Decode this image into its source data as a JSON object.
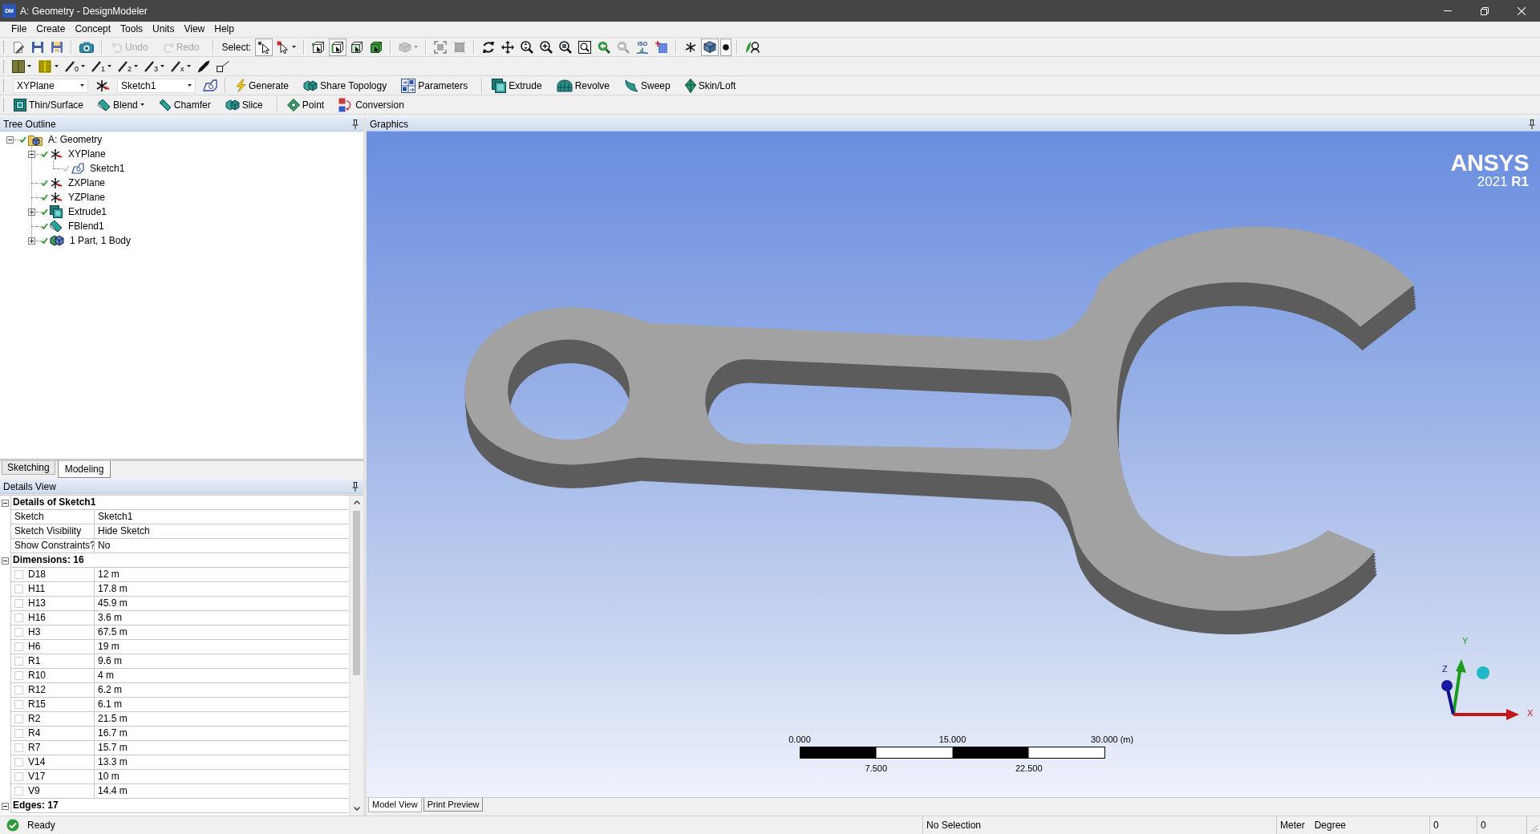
{
  "window": {
    "app_badge": "DM",
    "title": "A: Geometry - DesignModeler"
  },
  "menu": [
    "File",
    "Create",
    "Concept",
    "Tools",
    "Units",
    "View",
    "Help"
  ],
  "standard_toolbar": {
    "undo": {
      "label": "Undo",
      "disabled": true
    },
    "redo": {
      "label": "Redo",
      "disabled": true
    },
    "select_label": "Select:",
    "select_mode": {
      "selected": true
    },
    "selection_filters": [
      {
        "selected": false
      },
      {
        "selected": true
      },
      {
        "selected": false
      },
      {
        "selected": false
      }
    ],
    "extend_selection": {
      "disabled": true
    },
    "fit_buttons": [
      {
        "disabled": true
      },
      {
        "disabled": true
      }
    ],
    "view_tools": [
      {
        "disabled": false
      },
      {
        "disabled": false
      },
      {
        "disabled": false
      },
      {
        "disabled": false
      },
      {
        "disabled": false
      },
      {
        "disabled": false
      },
      {
        "disabled": false
      },
      {
        "disabled": true
      },
      {
        "label": "ISO",
        "disabled": false
      },
      {
        "disabled": false
      }
    ],
    "display_toggles": [
      {
        "selected": false
      },
      {
        "selected": true
      },
      {
        "selected": true
      }
    ]
  },
  "sketch_toolbar": {
    "line_buttons": [
      "0",
      "1",
      "2",
      "3",
      "x"
    ]
  },
  "feature_toolbar": {
    "plane": "XYPlane",
    "sketch": "Sketch1",
    "groups": [
      {
        "buttons": [
          {
            "label": "Generate"
          },
          {
            "label": "Share Topology"
          },
          {
            "label": "Parameters"
          }
        ]
      },
      {
        "buttons": [
          {
            "label": "Extrude"
          },
          {
            "label": "Revolve"
          },
          {
            "label": "Sweep"
          },
          {
            "label": "Skin/Loft"
          }
        ]
      }
    ]
  },
  "operations_toolbar": {
    "groups": [
      {
        "buttons": [
          {
            "label": "Thin/Surface",
            "kind": "button"
          },
          {
            "label": "Blend",
            "kind": "menu"
          },
          {
            "label": "Chamfer",
            "kind": "button"
          },
          {
            "label": "Slice",
            "kind": "button"
          }
        ]
      },
      {
        "buttons": [
          {
            "label": "Point",
            "kind": "button"
          },
          {
            "label": "Conversion",
            "kind": "button"
          }
        ]
      }
    ]
  },
  "tree_outline": {
    "title": "Tree Outline",
    "items": [
      {
        "label": "A: Geometry",
        "kind": "geometry",
        "color": "#3d9a3d",
        "expanded": true,
        "children": [
          {
            "label": "XYPlane",
            "kind": "plane",
            "color": "#3d9a3d",
            "expanded": true,
            "children": [
              {
                "label": "Sketch1",
                "kind": "sketch",
                "color": "#c4ccc4"
              }
            ]
          },
          {
            "label": "ZXPlane",
            "kind": "plane",
            "color": "#3d9a3d"
          },
          {
            "label": "YZPlane",
            "kind": "plane",
            "color": "#3d9a3d"
          },
          {
            "label": "Extrude1",
            "kind": "extrude",
            "color": "#3d9a3d",
            "expanded": false
          },
          {
            "label": "FBlend1",
            "kind": "blend",
            "color": "#3d9a3d"
          },
          {
            "label": "1 Part, 1 Body",
            "kind": "body",
            "color": "#3d9a3d",
            "expanded": false
          }
        ]
      }
    ]
  },
  "panel_tabs": [
    {
      "label": "Sketching",
      "selected": false
    },
    {
      "label": "Modeling",
      "selected": true
    }
  ],
  "details_view": {
    "title": "Details View",
    "groups": [
      {
        "label": "Details of Sketch1",
        "expanded": true,
        "rows": [
          {
            "kind": "property",
            "name": "Sketch",
            "value": "Sketch1"
          },
          {
            "kind": "property",
            "name": "Sketch Visibility",
            "value": "Hide Sketch"
          },
          {
            "kind": "property",
            "name": "Show Constraints?",
            "value": "No"
          }
        ]
      },
      {
        "label": "Dimensions: 16",
        "expanded": true,
        "rows": [
          {
            "kind": "dimension",
            "name": "D18",
            "value": "12 m",
            "checked": false
          },
          {
            "kind": "dimension",
            "name": "H11",
            "value": "17.8 m",
            "checked": false
          },
          {
            "kind": "dimension",
            "name": "H13",
            "value": "45.9 m",
            "checked": false
          },
          {
            "kind": "dimension",
            "name": "H16",
            "value": "3.6 m",
            "checked": false
          },
          {
            "kind": "dimension",
            "name": "H3",
            "value": "67.5 m",
            "checked": false
          },
          {
            "kind": "dimension",
            "name": "H6",
            "value": "19 m",
            "checked": false
          },
          {
            "kind": "dimension",
            "name": "R1",
            "value": "9.6 m",
            "checked": false
          },
          {
            "kind": "dimension",
            "name": "R10",
            "value": "4 m",
            "checked": false
          },
          {
            "kind": "dimension",
            "name": "R12",
            "value": "6.2 m",
            "checked": false
          },
          {
            "kind": "dimension",
            "name": "R15",
            "value": "6.1 m",
            "checked": false
          },
          {
            "kind": "dimension",
            "name": "R2",
            "value": "21.5 m",
            "checked": false
          },
          {
            "kind": "dimension",
            "name": "R4",
            "value": "16.7 m",
            "checked": false
          },
          {
            "kind": "dimension",
            "name": "R7",
            "value": "15.7 m",
            "checked": false
          },
          {
            "kind": "dimension",
            "name": "V14",
            "value": "13.3 m",
            "checked": false
          },
          {
            "kind": "dimension",
            "name": "V17",
            "value": "10 m",
            "checked": false
          },
          {
            "kind": "dimension",
            "name": "V9",
            "value": "14.4 m",
            "checked": false
          }
        ]
      },
      {
        "label": "Edges: 17",
        "expanded": true
      }
    ]
  },
  "graphics": {
    "title": "Graphics",
    "logo": {
      "wordmark": "ANSYS",
      "version": "2021 **R1**"
    },
    "scale_bar": {
      "top_labels": [
        "0.000",
        "15.000",
        "30.000 (m)"
      ],
      "bottom_labels": [
        "7.500",
        "22.500"
      ]
    },
    "axis_labels": [
      "Y",
      "Z",
      "X"
    ],
    "view_tabs": [
      {
        "label": "Model View",
        "selected": true
      },
      {
        "label": "Print Preview",
        "selected": false
      }
    ]
  },
  "status_bar": {
    "message": "Ready",
    "selection": "No Selection",
    "length_unit": "Meter",
    "angle_unit": "Degree",
    "fields": [
      "0",
      "0"
    ]
  }
}
